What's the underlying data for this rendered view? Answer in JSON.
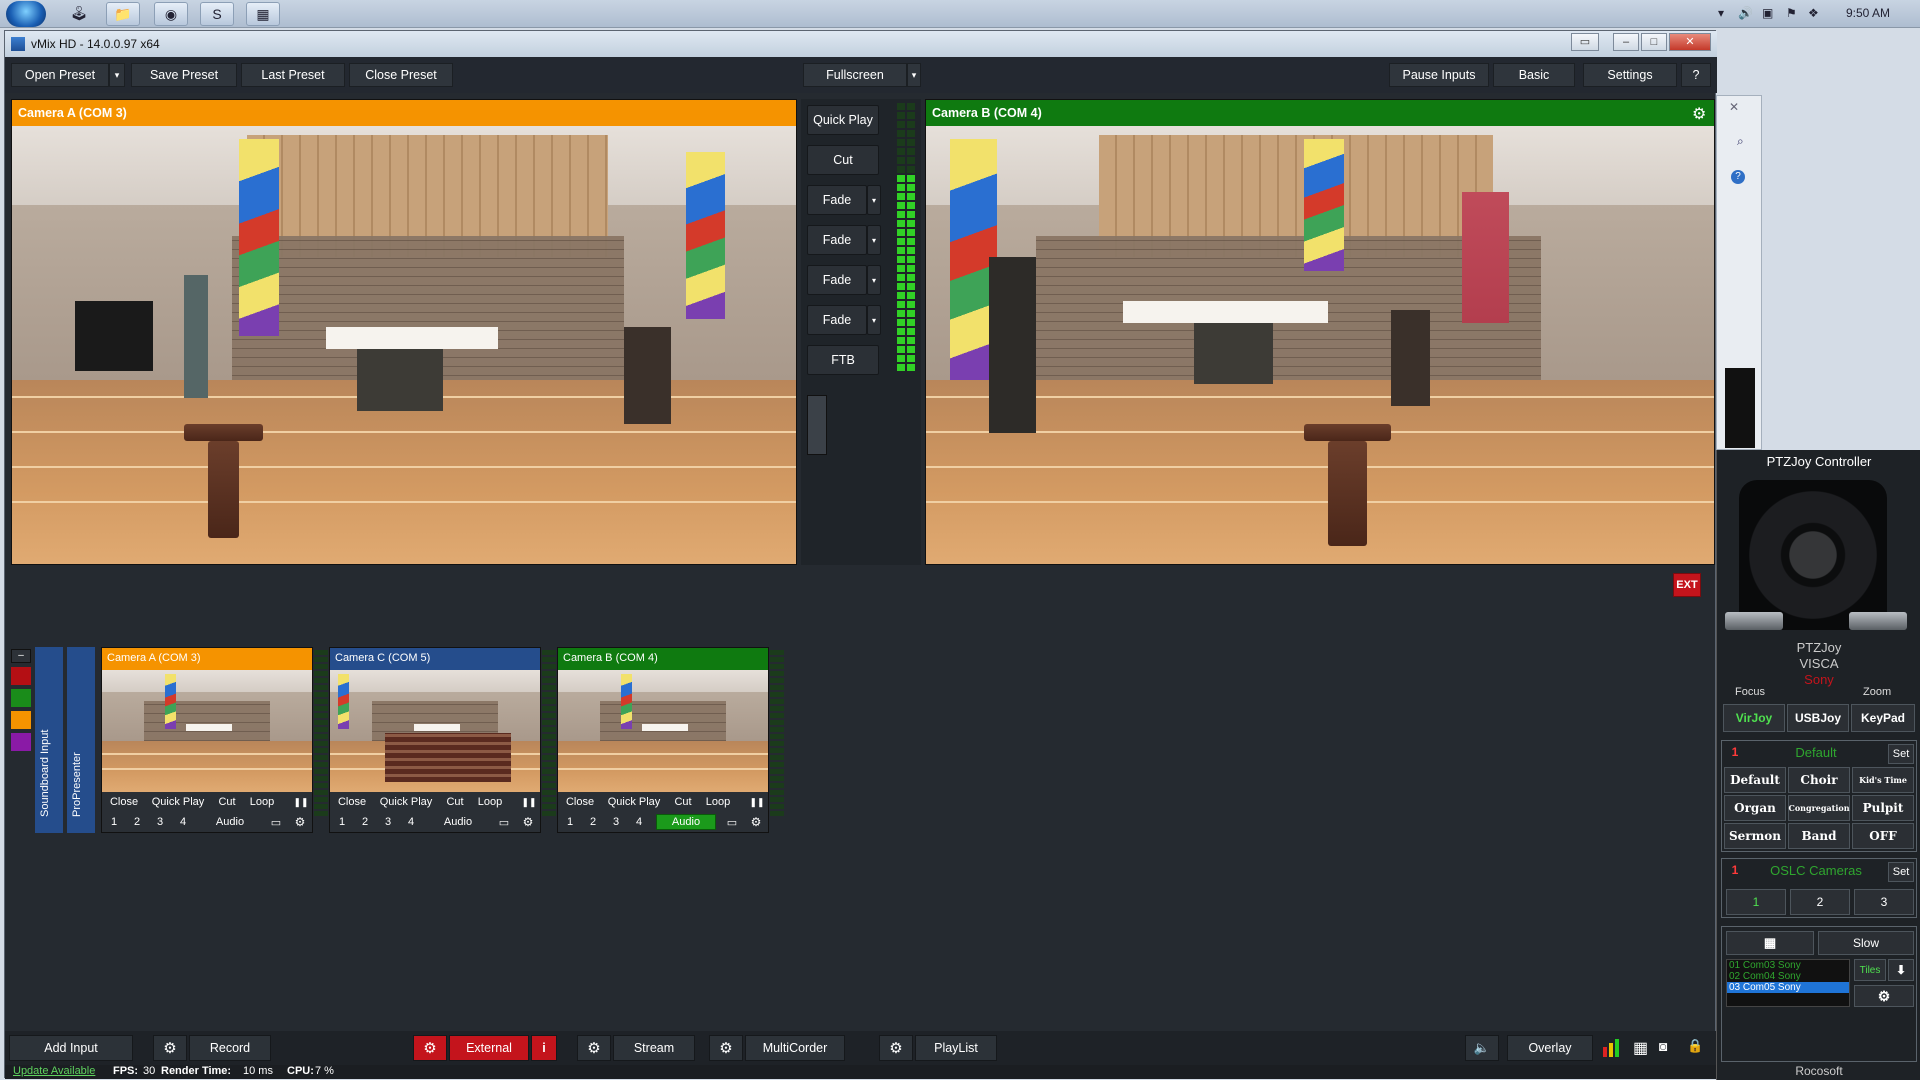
{
  "taskbar": {
    "clock": "9:50 AM",
    "apps": [
      "joystick-app-icon",
      "folder-icon",
      "chrome-icon",
      "skype-icon",
      "vmix-icon"
    ]
  },
  "window": {
    "title": "vMix HD - 14.0.0.97 x64"
  },
  "toolbar": {
    "open_preset": "Open Preset",
    "save_preset": "Save Preset",
    "last_preset": "Last Preset",
    "close_preset": "Close Preset",
    "fullscreen": "Fullscreen",
    "pause_inputs": "Pause Inputs",
    "basic": "Basic",
    "settings": "Settings",
    "help": "?"
  },
  "preview": {
    "title": "Camera A (COM 3)",
    "color": "#f59300"
  },
  "output": {
    "title": "Camera B (COM 4)",
    "color": "#0f7a10",
    "ext_label": "EXT"
  },
  "transitions": {
    "quick_play": "Quick Play",
    "cut": "Cut",
    "fades": [
      "Fade",
      "Fade",
      "Fade",
      "Fade"
    ],
    "ftb": "FTB"
  },
  "side_tabs": {
    "soundboard": "Soundboard Input",
    "propresenter": "ProPresenter"
  },
  "inputs": [
    {
      "title": "Camera A (COM 3)",
      "color": "#f59300",
      "controls": [
        "Close",
        "Quick Play",
        "Cut",
        "Loop"
      ],
      "numbers": [
        "1",
        "2",
        "3",
        "4"
      ],
      "audio": "Audio",
      "audio_active": false
    },
    {
      "title": "Camera C (COM 5)",
      "color": "#254d8c",
      "controls": [
        "Close",
        "Quick Play",
        "Cut",
        "Loop"
      ],
      "numbers": [
        "1",
        "2",
        "3",
        "4"
      ],
      "audio": "Audio",
      "audio_active": false
    },
    {
      "title": "Camera B (COM 4)",
      "color": "#0f7a10",
      "controls": [
        "Close",
        "Quick Play",
        "Cut",
        "Loop"
      ],
      "numbers": [
        "1",
        "2",
        "3",
        "4"
      ],
      "audio": "Audio",
      "audio_active": true
    }
  ],
  "bottombar": {
    "add_input": "Add Input",
    "record": "Record",
    "external": "External",
    "external_info": "i",
    "stream": "Stream",
    "multicorder": "MultiCorder",
    "playlist": "PlayList",
    "overlay": "Overlay"
  },
  "statusbar": {
    "update": "Update Available",
    "fps_label": "FPS:",
    "fps": "30",
    "render_label": "Render Time:",
    "render": "10 ms",
    "cpu_label": "CPU:",
    "cpu": "7 %"
  },
  "ptz": {
    "title": "PTZJoy Controller",
    "brand": "PTZJoy",
    "protocol": "VISCA",
    "vendor": "Sony",
    "focus": "Focus",
    "zoom": "Zoom",
    "modes": [
      "VirJoy",
      "USBJoy",
      "KeyPad"
    ],
    "preset_bank_num": "1",
    "preset_bank_name": "Default",
    "set": "Set",
    "presets": [
      "Default",
      "Choir",
      "Kid's Time",
      "Organ",
      "Congregation",
      "Pulpit",
      "Sermon",
      "Band",
      "OFF"
    ],
    "camera_bank_num": "1",
    "camera_bank_name": "OSLC Cameras",
    "cameras": [
      "1",
      "2",
      "3"
    ],
    "slow": "Slow",
    "tiles": "Tiles",
    "cam_list": [
      "01 Com03 Sony",
      "02 Com04 Sony",
      "03 Com05 Sony"
    ],
    "footer": "Rocosoft"
  }
}
